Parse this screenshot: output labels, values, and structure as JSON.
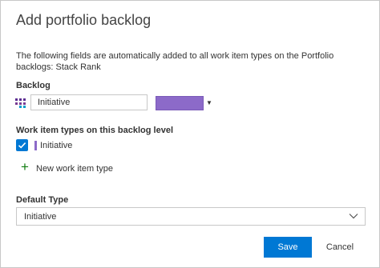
{
  "dialog": {
    "title": "Add portfolio backlog",
    "description": "The following fields are automatically added to all work item types on the Portfolio backlogs: Stack Rank"
  },
  "backlog": {
    "label": "Backlog",
    "name_value": "Initiative",
    "color": "#8c6ac9",
    "icon": "backlog-levels-icon"
  },
  "work_item_types": {
    "label": "Work item types on this backlog level",
    "items": [
      {
        "label": "Initiative",
        "checked": true,
        "color": "#8c6ac9"
      }
    ],
    "add_label": "New work item type",
    "add_icon": "plus-icon"
  },
  "default_type": {
    "label": "Default Type",
    "value": "Initiative"
  },
  "footer": {
    "save_label": "Save",
    "cancel_label": "Cancel"
  },
  "colors": {
    "accent": "#0078d4",
    "add_icon": "#107c10"
  }
}
